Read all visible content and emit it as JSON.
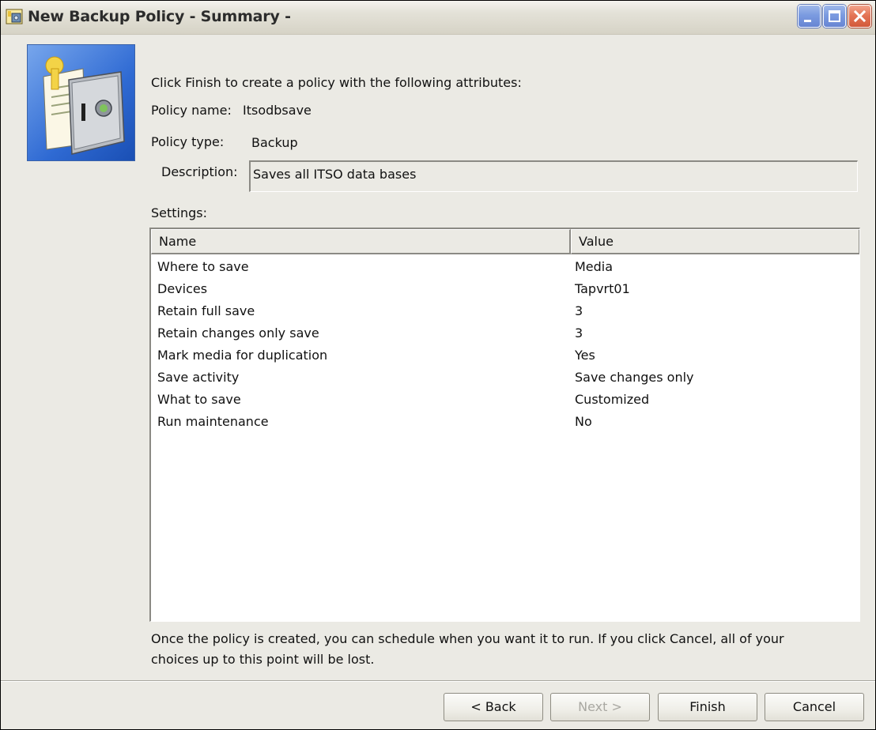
{
  "window": {
    "title": "New Backup Policy - Summary -"
  },
  "summary": {
    "intro": "Click Finish to create a policy with the following attributes:",
    "policy_name_label": "Policy name:",
    "policy_name_value": "Itsodbsave",
    "policy_type_label": "Policy type:",
    "policy_type_value": "Backup",
    "description_label": "Description:",
    "description_value": "Saves all ITSO data bases",
    "settings_label": "Settings:"
  },
  "settings_table": {
    "columns": [
      "Name",
      "Value"
    ],
    "rows": [
      {
        "name": "Where to save",
        "value": "Media"
      },
      {
        "name": "Devices",
        "value": "Tapvrt01"
      },
      {
        "name": "Retain full save",
        "value": "3"
      },
      {
        "name": "Retain changes only save",
        "value": "3"
      },
      {
        "name": "Mark media for duplication",
        "value": "Yes"
      },
      {
        "name": "Save activity",
        "value": "Save changes only"
      },
      {
        "name": "What to save",
        "value": "Customized"
      },
      {
        "name": "Run maintenance",
        "value": "No"
      }
    ]
  },
  "note": {
    "line1": "Once the policy is created, you can schedule when you want it to run. If you click Cancel, all of your",
    "line2": "choices up to this point will be lost."
  },
  "buttons": {
    "back": "< Back",
    "next": "Next >",
    "finish": "Finish",
    "cancel": "Cancel"
  }
}
